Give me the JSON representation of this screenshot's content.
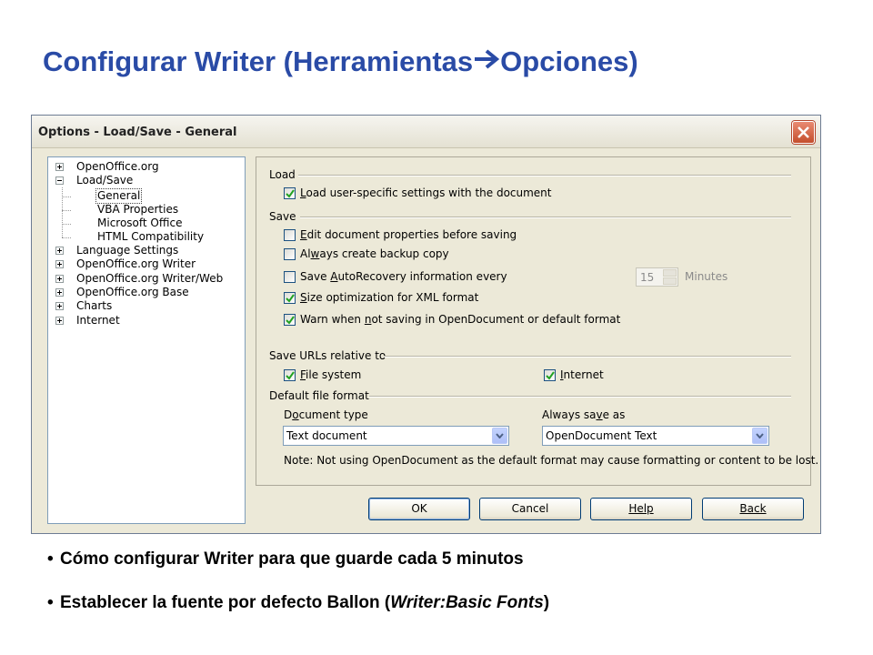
{
  "slide": {
    "title_before": "Configurar Writer (Herramientas",
    "title_after": "Opciones)",
    "arrow_icon": "right-arrow-icon",
    "title_color": "#2a4ba6",
    "bullets": [
      {
        "text": "Cómo configurar Writer para que guarde cada 5 minutos"
      },
      {
        "prefix": "Establecer la fuente por defecto Ballon (",
        "italic": "Writer:Basic Fonts",
        "suffix": ")"
      }
    ]
  },
  "dialog": {
    "title": "Options - Load/Save - General",
    "close_icon": "close-icon",
    "tree": [
      {
        "label": "OpenOffice.org",
        "expander": "plus"
      },
      {
        "label": "Load/Save",
        "expander": "minus"
      },
      {
        "label": "General",
        "child": true,
        "selected": true
      },
      {
        "label": "VBA Properties",
        "child": true
      },
      {
        "label": "Microsoft Office",
        "child": true
      },
      {
        "label": "HTML Compatibility",
        "child": true
      },
      {
        "label": "Language Settings",
        "expander": "plus"
      },
      {
        "label": "OpenOffice.org Writer",
        "expander": "plus"
      },
      {
        "label": "OpenOffice.org Writer/Web",
        "expander": "plus"
      },
      {
        "label": "OpenOffice.org Base",
        "expander": "plus"
      },
      {
        "label": "Charts",
        "expander": "plus"
      },
      {
        "label": "Internet",
        "expander": "plus"
      }
    ],
    "load": {
      "label": "Load",
      "user_settings": {
        "pre": "",
        "key": "L",
        "post": "oad user-specific settings with the document",
        "checked": true
      }
    },
    "save": {
      "label": "Save",
      "edit_props": {
        "pre": "",
        "key": "E",
        "post": "dit document properties before saving",
        "checked": false
      },
      "backup": {
        "pre": "Al",
        "key": "w",
        "post": "ays create backup copy",
        "checked": false
      },
      "autorecovery": {
        "pre": "Save ",
        "key": "A",
        "post": "utoRecovery information every",
        "checked": false
      },
      "autorecovery_value": "15",
      "autorecovery_units": "Minutes",
      "size_opt": {
        "pre": "",
        "key": "S",
        "post": "ize optimization for XML format",
        "checked": true
      },
      "warn": {
        "pre": "Warn when ",
        "key": "n",
        "post": "ot saving in OpenDocument or default format",
        "checked": true
      }
    },
    "urls": {
      "label": "Save URLs relative to",
      "file_system": {
        "pre": "",
        "key": "F",
        "post": "ile system",
        "checked": true
      },
      "internet": {
        "pre": "",
        "key": "I",
        "post": "nternet",
        "checked": true
      }
    },
    "format": {
      "label": "Default file format",
      "doc_type_label": {
        "pre": "D",
        "key": "o",
        "post": "cument type"
      },
      "doc_type_value": "Text document",
      "always_save_label": {
        "pre": "Always sa",
        "key": "v",
        "post": "e as"
      },
      "always_save_value": "OpenDocument Text",
      "note": "Note: Not using OpenDocument as the default format may cause formatting or content to be lost."
    },
    "buttons": {
      "ok": "OK",
      "cancel": "Cancel",
      "help": "Help",
      "back": "Back"
    },
    "colors": {
      "check_mark": "#21a121",
      "dialog_bg": "#ece9d8",
      "close_button": "#c44e2c"
    }
  }
}
